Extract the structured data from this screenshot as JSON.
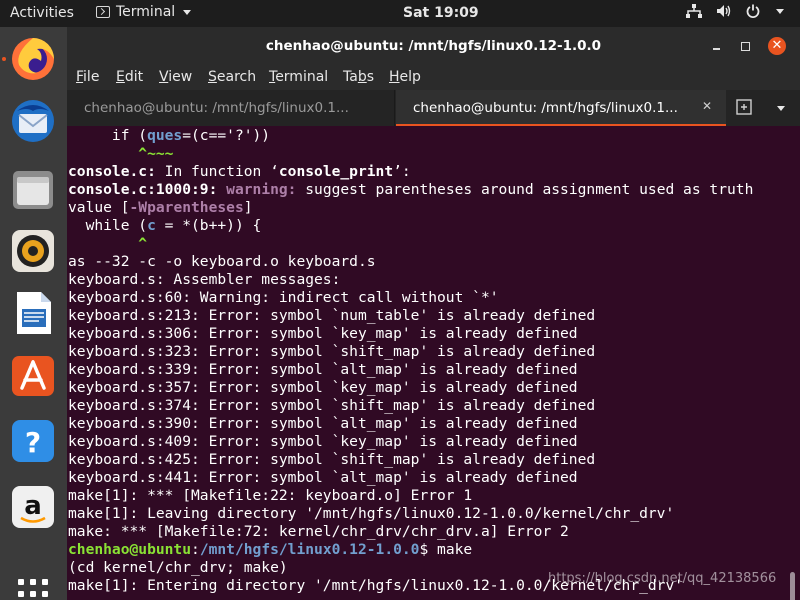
{
  "topbar": {
    "activities": "Activities",
    "app_name": "Terminal",
    "clock": "Sat 19:09",
    "icons": [
      "network-icon",
      "volume-icon",
      "power-icon",
      "chevron-down-icon"
    ]
  },
  "dock": {
    "apps": [
      "Firefox",
      "Thunderbird",
      "Files",
      "Rhythmbox",
      "LibreOffice Writer",
      "Ubuntu Software",
      "Help",
      "Amazon"
    ],
    "show_apps_icon": "apps-grid-icon"
  },
  "window": {
    "title": "chenhao@ubuntu: /mnt/hgfs/linux0.12-1.0.0",
    "controls": {
      "close_glyph": "✕"
    }
  },
  "menu": [
    {
      "label": "File",
      "underline": "F",
      "rest": "ile"
    },
    {
      "label": "Edit",
      "underline": "E",
      "rest": "dit"
    },
    {
      "label": "View",
      "underline": "V",
      "rest": "iew"
    },
    {
      "label": "Search",
      "underline": "S",
      "rest": "earch"
    },
    {
      "label": "Terminal",
      "underline": "T",
      "rest": "erminal"
    },
    {
      "label": "Tabs",
      "pre": "Ta",
      "underline": "b",
      "rest": "s"
    },
    {
      "label": "Help",
      "underline": "H",
      "rest": "elp"
    }
  ],
  "tabs": [
    {
      "label": "chenhao@ubuntu: /mnt/hgfs/linux0.1...",
      "active": false
    },
    {
      "label": "chenhao@ubuntu: /mnt/hgfs/linux0.1...",
      "active": true
    }
  ],
  "tab_close_glyph": "✕",
  "terminal_lines": [
    [
      {
        "t": "     if ("
      },
      {
        "t": "ques",
        "c": "bl"
      },
      {
        "t": "=(c=='?'))"
      }
    ],
    [
      {
        "t": "        "
      },
      {
        "t": "^~~~",
        "c": "g"
      }
    ],
    [
      {
        "t": "console.c:",
        "c": "b"
      },
      {
        "t": " In function ‘"
      },
      {
        "t": "console_print",
        "c": "b"
      },
      {
        "t": "’:"
      }
    ],
    [
      {
        "t": "console.c:1000:9:",
        "c": "b"
      },
      {
        "t": " "
      },
      {
        "t": "warning:",
        "c": "mg"
      },
      {
        "t": " suggest parentheses around assignment used as truth"
      }
    ],
    [
      {
        "t": "value ["
      },
      {
        "t": "-Wparentheses",
        "c": "mg"
      },
      {
        "t": "]"
      }
    ],
    [
      {
        "t": "  while ("
      },
      {
        "t": "c",
        "c": "bl"
      },
      {
        "t": " = *(b++)) {"
      }
    ],
    [
      {
        "t": "        "
      },
      {
        "t": "^",
        "c": "g"
      }
    ],
    [
      {
        "t": "as --32 -c -o keyboard.o keyboard.s"
      }
    ],
    [
      {
        "t": "keyboard.s: Assembler messages:"
      }
    ],
    [
      {
        "t": "keyboard.s:60: Warning: indirect call without `*'"
      }
    ],
    [
      {
        "t": "keyboard.s:213: Error: symbol `num_table' is already defined"
      }
    ],
    [
      {
        "t": "keyboard.s:306: Error: symbol `key_map' is already defined"
      }
    ],
    [
      {
        "t": "keyboard.s:323: Error: symbol `shift_map' is already defined"
      }
    ],
    [
      {
        "t": "keyboard.s:339: Error: symbol `alt_map' is already defined"
      }
    ],
    [
      {
        "t": "keyboard.s:357: Error: symbol `key_map' is already defined"
      }
    ],
    [
      {
        "t": "keyboard.s:374: Error: symbol `shift_map' is already defined"
      }
    ],
    [
      {
        "t": "keyboard.s:390: Error: symbol `alt_map' is already defined"
      }
    ],
    [
      {
        "t": "keyboard.s:409: Error: symbol `key_map' is already defined"
      }
    ],
    [
      {
        "t": "keyboard.s:425: Error: symbol `shift_map' is already defined"
      }
    ],
    [
      {
        "t": "keyboard.s:441: Error: symbol `alt_map' is already defined"
      }
    ],
    [
      {
        "t": "make[1]: *** [Makefile:22: keyboard.o] Error 1"
      }
    ],
    [
      {
        "t": "make[1]: Leaving directory '/mnt/hgfs/linux0.12-1.0.0/kernel/chr_drv'"
      }
    ],
    [
      {
        "t": "make: *** [Makefile:72: kernel/chr_drv/chr_drv.a] Error 2"
      }
    ],
    [
      {
        "t": "chenhao@ubuntu",
        "c": "g"
      },
      {
        "t": ":"
      },
      {
        "t": "/mnt/hgfs/linux0.12-1.0.0",
        "c": "bl"
      },
      {
        "t": "$ make"
      }
    ],
    [
      {
        "t": "(cd kernel/chr_drv; make)"
      }
    ],
    [
      {
        "t": "make[1]: Entering directory '/mnt/hgfs/linux0.12-1.0.0/kernel/chr_drv'"
      }
    ]
  ],
  "watermark": "https://blog.csdn.net/qq_42138566"
}
